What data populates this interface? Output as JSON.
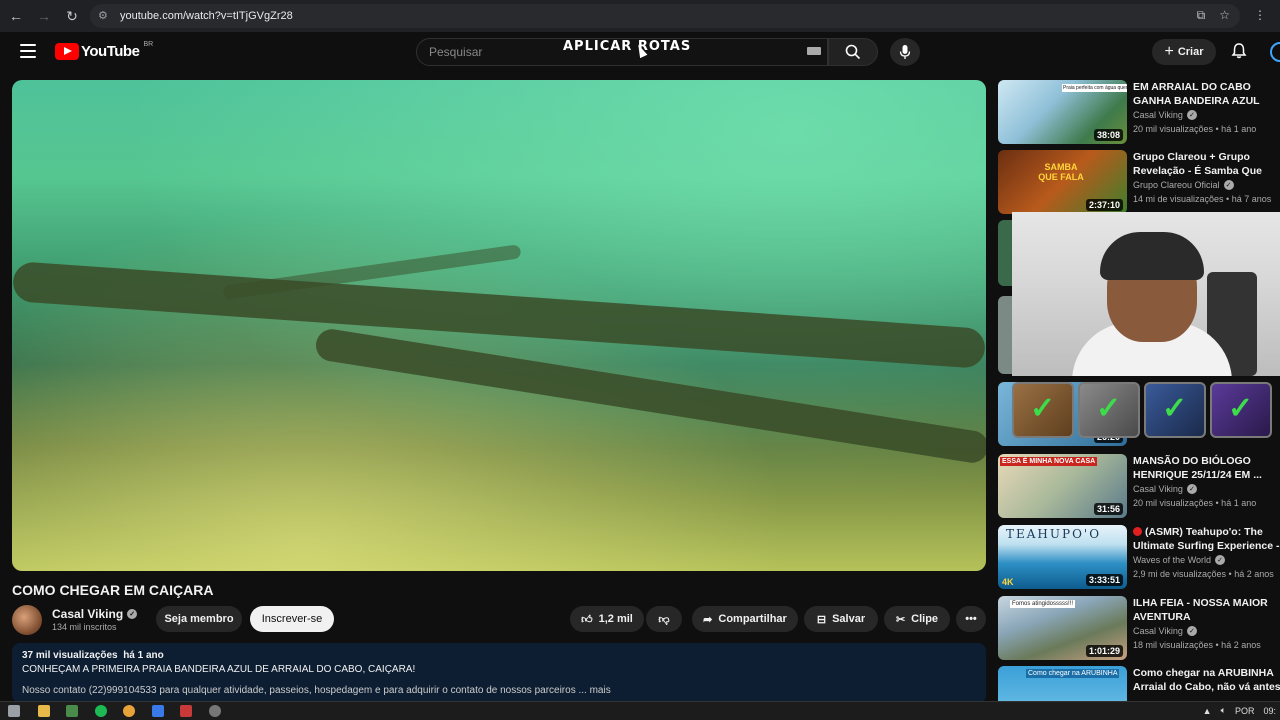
{
  "browser": {
    "url": "youtube.com/watch?v=tITjGVgZr28"
  },
  "header": {
    "logo_text": "YouTube",
    "country_code": "BR",
    "search_placeholder": "Pesquisar",
    "overlay_title": "APLICAR ROTAS",
    "create_label": "Criar"
  },
  "video": {
    "title": "COMO CHEGAR EM CAIÇARA",
    "channel": "Casal Viking",
    "subscribers": "134 mil inscritos",
    "join_label": "Seja membro",
    "subscribe_label": "Inscrever-se",
    "likes": "1,2 mil",
    "share_label": "Compartilhar",
    "save_label": "Salvar",
    "clip_label": "Clipe"
  },
  "description": {
    "views": "37 mil visualizações",
    "age": "há 1 ano",
    "line1": "CONHEÇAM A PRIMEIRA PRAIA BANDEIRA AZUL DE ARRAIAL DO CABO, CAIÇARA!",
    "line2": "Nosso contato (22)999104533 para qualquer atividade, passeios, hospedagem e para adquirir o contato de nossos parceiros ... mais"
  },
  "sidebar": {
    "items": [
      {
        "title": "EM ARRAIAL DO CABO GANHA BANDEIRA AZUL",
        "channel": "Casal Viking",
        "meta": "20 mil visualizações • há 1 ano",
        "duration": "38:08",
        "thumb_label": "Praia perfeita com água quente!",
        "verified": true
      },
      {
        "title": "Grupo Clareou + Grupo Revelação - É Samba Que Fala",
        "channel": "Grupo Clareou Oficial",
        "meta": "14 mi de visualizações • há 7 anos",
        "duration": "2:37:10",
        "thumb_label": "SAMBA QUE FALA",
        "verified": true
      },
      {
        "title": "MANSÃO DO BIÓLOGO HENRIQUE 25/11/24 EM ...",
        "channel": "Casal Viking",
        "meta": "20 mil visualizações • há 1 ano",
        "duration": "31:56",
        "thumb_label": "ESSA É MINHA NOVA CASA",
        "verified": true
      },
      {
        "title": "(ASMR) Teahupo'o: The Ultimate Surfing Experience -",
        "channel": "Waves of the World",
        "meta": "2,9 mi de visualizações • há 2 anos",
        "duration": "3:33:51",
        "thumb_label": "TEAHUPO'O",
        "badge": "4K",
        "verified": true
      },
      {
        "title": "ILHA FEIA - NOSSA MAIOR AVENTURA",
        "channel": "Casal Viking",
        "meta": "18 mil visualizações • há 2 anos",
        "duration": "1:01:29",
        "thumb_label": "Fomos atingidosssss!!!",
        "verified": true
      },
      {
        "title": "Como chegar na ARUBINHA Arraial do Cabo, não vá antes",
        "thumb_label": "Como chegar na ARUBINHA"
      }
    ],
    "partial_duration": "26:20"
  },
  "taskbar": {
    "language": "POR",
    "time": "09:"
  },
  "colors": {
    "background": "#0f0f0f",
    "youtube_red": "#ff0000",
    "description_bg": "#0d1e33",
    "check_green": "#3ddc4b"
  }
}
